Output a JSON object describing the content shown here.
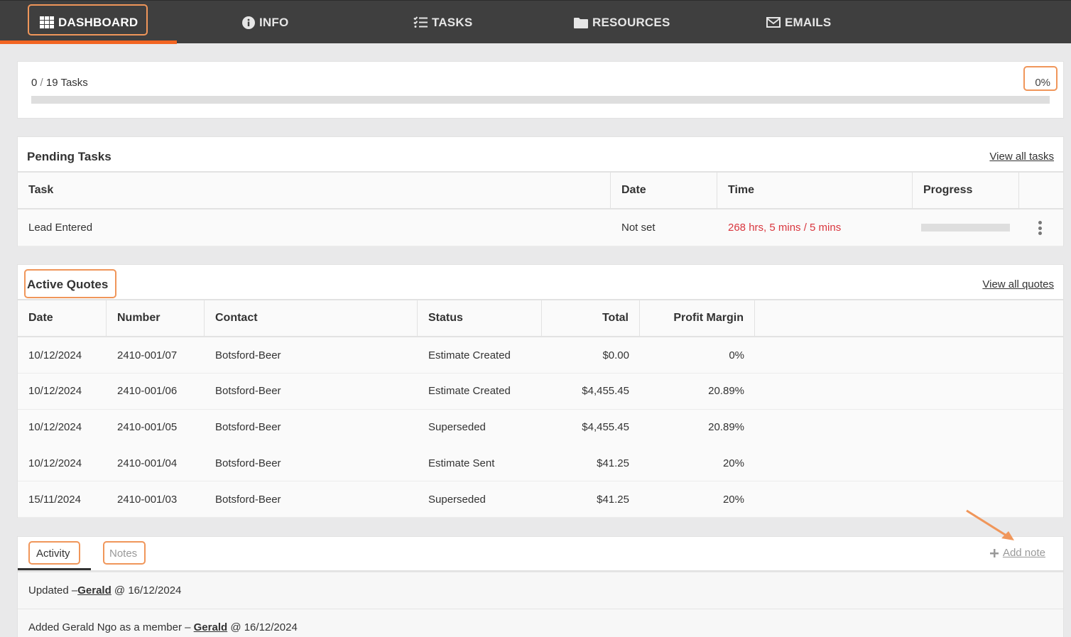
{
  "nav": {
    "items": [
      {
        "label": "DASHBOARD",
        "icon": "grid-icon"
      },
      {
        "label": "INFO",
        "icon": "info-icon"
      },
      {
        "label": "TASKS",
        "icon": "tasks-icon"
      },
      {
        "label": "RESOURCES",
        "icon": "folder-icon"
      },
      {
        "label": "EMAILS",
        "icon": "envelope-icon"
      }
    ],
    "active": "DASHBOARD",
    "accent": "#f26522",
    "highlight": "#f0965a"
  },
  "progress": {
    "done": "0",
    "separator": "/",
    "total_label": "19 Tasks",
    "percent_label": "0%",
    "fraction": 0
  },
  "pending": {
    "title": "Pending Tasks",
    "view_all": "View all tasks",
    "headers": [
      "Task",
      "Date",
      "Time",
      "Progress"
    ],
    "rows": [
      {
        "task": "Lead Entered",
        "date": "Not set",
        "time": "268 hrs, 5 mins / 5 mins",
        "progress": 0,
        "time_color": "#d9363e"
      }
    ]
  },
  "quotes": {
    "title": "Active Quotes",
    "view_all": "View all quotes",
    "headers": [
      "Date",
      "Number",
      "Contact",
      "Status",
      "Total",
      "Profit Margin"
    ],
    "rows": [
      [
        "10/12/2024",
        "2410-001/07",
        "Botsford-Beer",
        "Estimate Created",
        "$0.00",
        "0%"
      ],
      [
        "10/12/2024",
        "2410-001/06",
        "Botsford-Beer",
        "Estimate Created",
        "$4,455.45",
        "20.89%"
      ],
      [
        "10/12/2024",
        "2410-001/05",
        "Botsford-Beer",
        "Superseded",
        "$4,455.45",
        "20.89%"
      ],
      [
        "10/12/2024",
        "2410-001/04",
        "Botsford-Beer",
        "Estimate Sent",
        "$41.25",
        "20%"
      ],
      [
        "15/11/2024",
        "2410-001/03",
        "Botsford-Beer",
        "Superseded",
        "$41.25",
        "20%"
      ]
    ]
  },
  "activity": {
    "tabs": [
      "Activity",
      "Notes"
    ],
    "active_tab": "Activity",
    "add_note": "Add note",
    "entries": [
      {
        "text": "Updated – ",
        "user": "Gerald",
        "at": " @ 16/12/2024"
      },
      {
        "text": "Added Gerald Ngo as a member – ",
        "user": "Gerald",
        "at": " @ 16/12/2024"
      }
    ]
  }
}
